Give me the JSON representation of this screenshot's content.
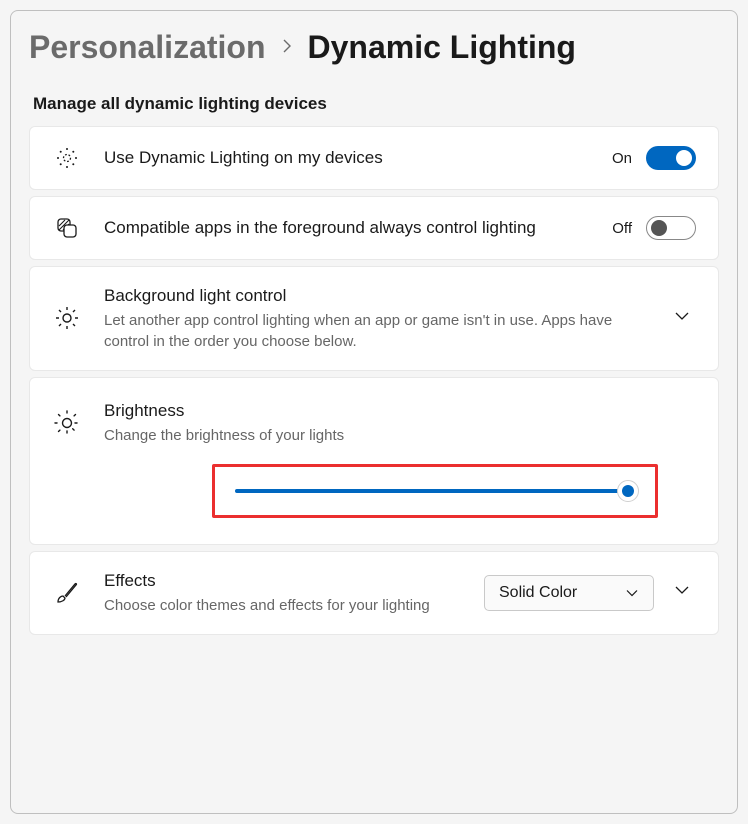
{
  "breadcrumb": {
    "parent": "Personalization",
    "current": "Dynamic Lighting"
  },
  "section_title": "Manage all dynamic lighting devices",
  "cards": {
    "use_dl": {
      "title": "Use Dynamic Lighting on my devices",
      "state_label": "On",
      "on": true
    },
    "compat_apps": {
      "title": "Compatible apps in the foreground always control lighting",
      "state_label": "Off",
      "on": false
    },
    "bg_control": {
      "title": "Background light control",
      "desc": "Let another app control lighting when an app or game isn't in use. Apps have control in the order you choose below."
    },
    "brightness": {
      "title": "Brightness",
      "desc": "Change the brightness of your lights",
      "value": 100
    },
    "effects": {
      "title": "Effects",
      "desc": "Choose color themes and effects for your lighting",
      "selected": "Solid Color"
    }
  }
}
